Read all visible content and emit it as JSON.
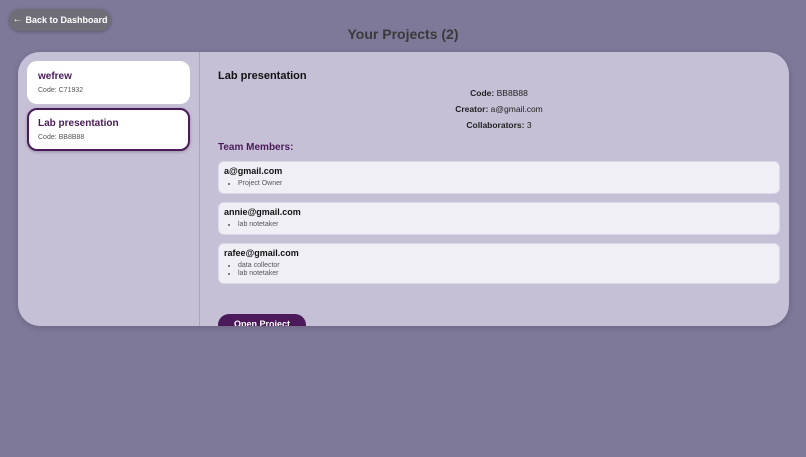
{
  "header": {
    "back_arrow": "←",
    "back_label": "Back to Dashboard",
    "title": "Your Projects (2)"
  },
  "projects": [
    {
      "name": "wefrew",
      "code": "Code: C71932",
      "selected": false
    },
    {
      "name": "Lab presentation",
      "code": "Code: BB8B88",
      "selected": true
    }
  ],
  "detail": {
    "title": "Lab presentation",
    "code_label": "Code:",
    "code_value": "BB8B88",
    "creator_label": "Creator:",
    "creator_value": "a@gmail.com",
    "collaborators_label": "Collaborators:",
    "collaborators_value": "3",
    "team_heading": "Team Members:",
    "members": [
      {
        "email": "a@gmail.com",
        "roles": [
          "Project Owner"
        ]
      },
      {
        "email": "annie@gmail.com",
        "roles": [
          "lab notetaker"
        ]
      },
      {
        "email": "rafee@gmail.com",
        "roles": [
          "data collector",
          "lab notetaker"
        ]
      }
    ],
    "open_button": "Open Project"
  },
  "colors": {
    "background": "#7e7899",
    "panel": "#c6c0d6",
    "accent": "#4a1a5a",
    "back_button": "#6f6e78"
  }
}
